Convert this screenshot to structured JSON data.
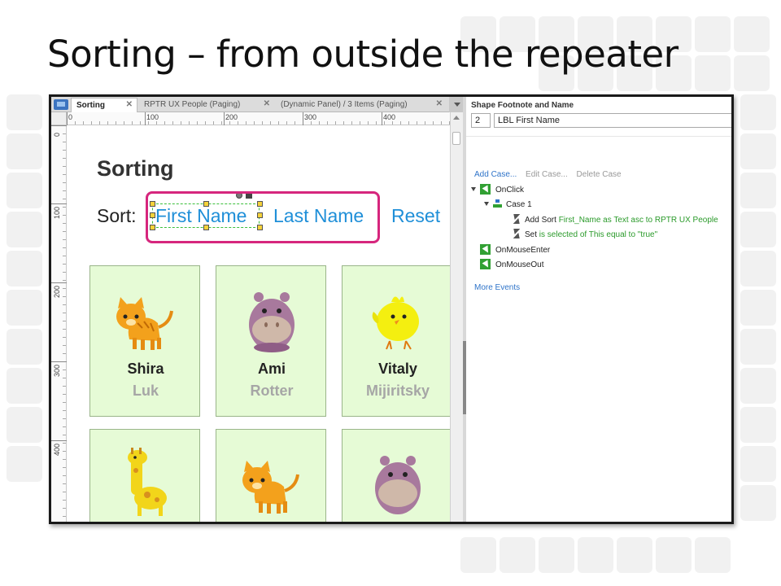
{
  "slide": {
    "title": "Sorting – from outside the repeater"
  },
  "tabs": [
    {
      "label": "Sorting",
      "active": true
    },
    {
      "label": "RPTR UX People (Paging)",
      "active": false
    },
    {
      "label": "(Dynamic Panel) / 3 Items (Paging)",
      "active": false
    }
  ],
  "rulers": {
    "horizontal": [
      "0",
      "100",
      "200",
      "300",
      "400"
    ],
    "vertical": [
      "0",
      "100",
      "200",
      "300",
      "400"
    ]
  },
  "canvas": {
    "heading": "Sorting",
    "sort_label": "Sort:",
    "links": [
      "First Name",
      "Last Name",
      "Reset"
    ],
    "highlight_color": "#d6267d",
    "link_color": "#1f8fd8",
    "cards": [
      {
        "first": "Shira",
        "last": "Luk",
        "animal": "cat-icon"
      },
      {
        "first": "Ami",
        "last": "Rotter",
        "animal": "hippo-icon"
      },
      {
        "first": "Vitaly",
        "last": "Mijiritsky",
        "animal": "chick-icon"
      },
      {
        "first": "",
        "last": "",
        "animal": "giraffe-icon"
      },
      {
        "first": "",
        "last": "",
        "animal": "cat-icon"
      },
      {
        "first": "",
        "last": "",
        "animal": "hippo-icon"
      }
    ]
  },
  "panel": {
    "header": "Shape Footnote and Name",
    "footnote_number": "2",
    "shape_name": "LBL First Name",
    "actions": {
      "add": "Add Case...",
      "edit": "Edit Case...",
      "delete": "Delete Case"
    },
    "tree": {
      "onclick": "OnClick",
      "case1": "Case 1",
      "action1_prefix": "Add Sort ",
      "action1_detail": "First_Name as Text asc to RPTR UX People",
      "action2_prefix": "Set ",
      "action2_detail": "is selected of This equal to \"true\"",
      "onmouseenter": "OnMouseEnter",
      "onmouseout": "OnMouseOut"
    },
    "more_events": "More Events"
  }
}
